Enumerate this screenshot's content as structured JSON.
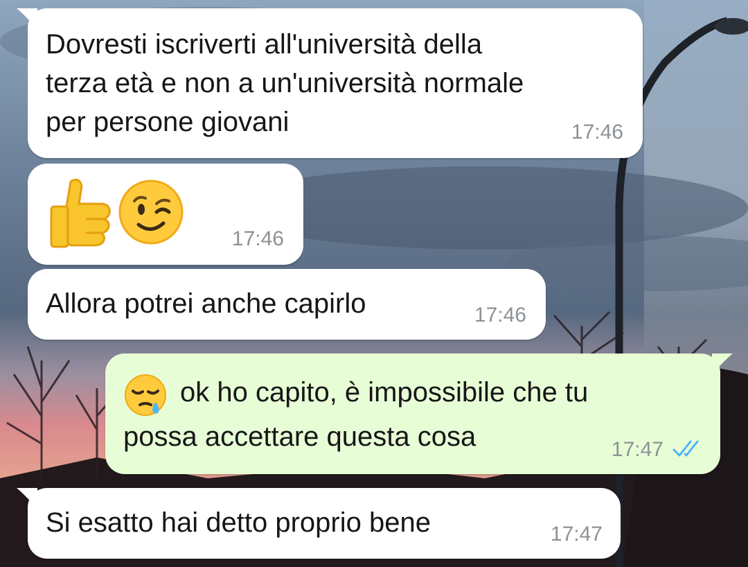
{
  "messages": [
    {
      "direction": "incoming",
      "lines": [
        "Dovresti iscriverti all'università della",
        "terza età e non a un'università normale",
        "per persone giovani"
      ],
      "time": "17:46"
    },
    {
      "direction": "incoming",
      "emoji": [
        "thumbs-up",
        "winking-face"
      ],
      "time": "17:46"
    },
    {
      "direction": "incoming",
      "lines": [
        "Allora potrei anche capirlo"
      ],
      "time": "17:46"
    },
    {
      "direction": "outgoing",
      "emoji": [
        "sleepy-face"
      ],
      "lines": [
        "ok ho capito, è impossibile che tu",
        "possa accettare questa cosa"
      ],
      "time": "17:47",
      "status": "read"
    },
    {
      "direction": "incoming",
      "lines": [
        "Si esatto hai detto proprio bene"
      ],
      "time": "17:47"
    }
  ],
  "colors": {
    "incoming_bubble": "#ffffff",
    "outgoing_bubble": "#e7fdd6",
    "timestamp": "#8c9196",
    "read_checks": "#4fb3f6"
  }
}
